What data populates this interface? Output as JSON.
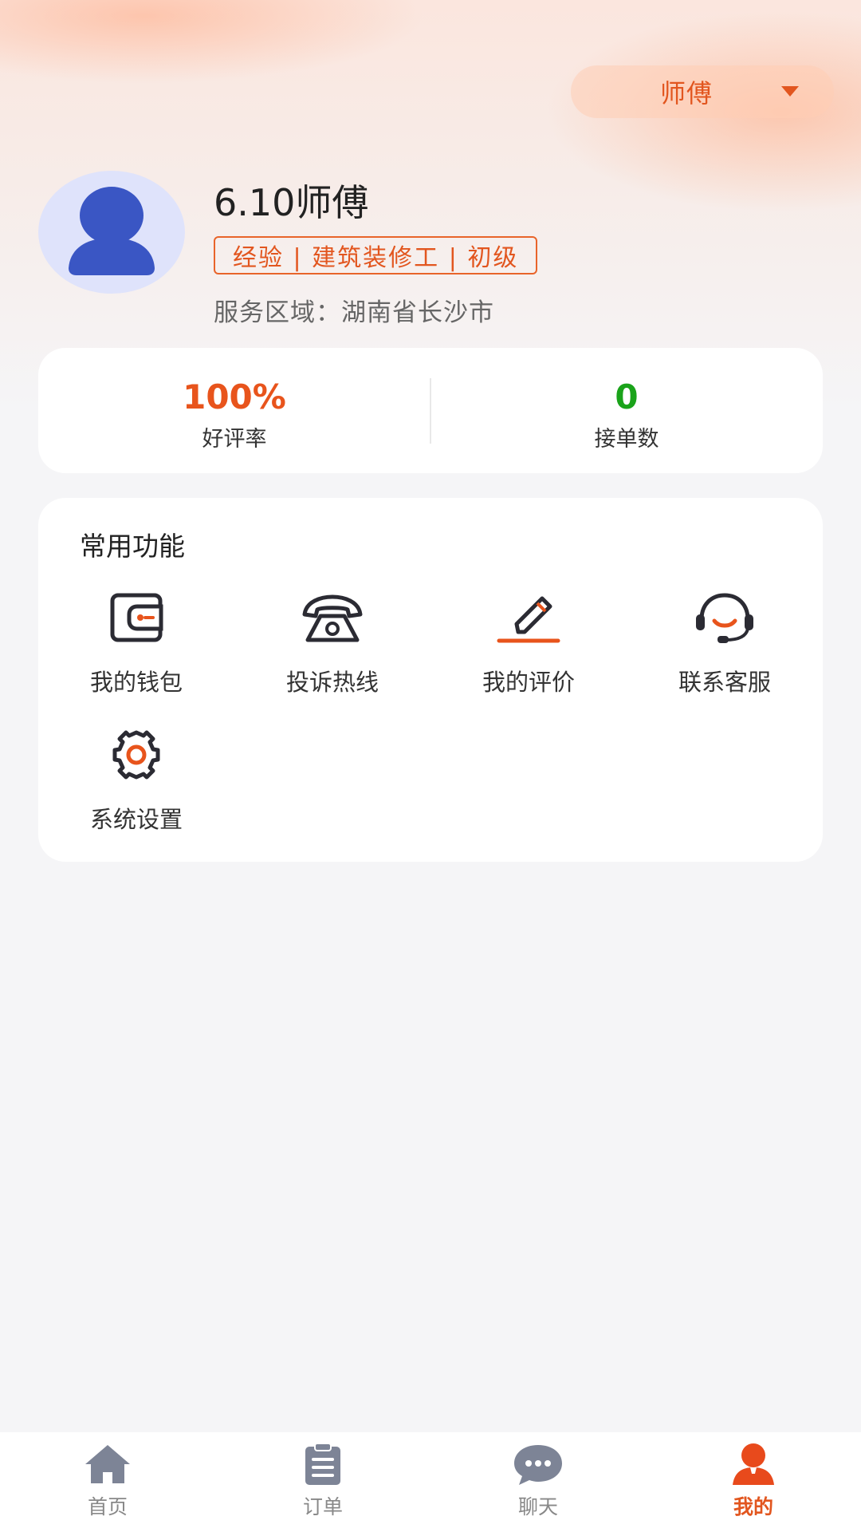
{
  "header": {
    "role_label": "师傅"
  },
  "profile": {
    "name": "6.10师傅",
    "tags": "经验 | 建筑装修工 | 初级",
    "area": "服务区域：湖南省长沙市"
  },
  "stats": [
    {
      "value": "100%",
      "label": "好评率",
      "color": "#e8541c"
    },
    {
      "value": "0",
      "label": "接单数",
      "color": "#1aa31a"
    }
  ],
  "functions": {
    "title": "常用功能",
    "items": [
      {
        "label": "我的钱包",
        "icon": "wallet-icon"
      },
      {
        "label": "投诉热线",
        "icon": "telephone-icon"
      },
      {
        "label": "我的评价",
        "icon": "pencil-icon"
      },
      {
        "label": "联系客服",
        "icon": "headset-icon"
      },
      {
        "label": "系统设置",
        "icon": "gear-icon"
      }
    ]
  },
  "tabbar": {
    "tabs": [
      {
        "label": "首页",
        "icon": "home-icon"
      },
      {
        "label": "订单",
        "icon": "clipboard-icon"
      },
      {
        "label": "聊天",
        "icon": "chat-icon"
      },
      {
        "label": "我的",
        "icon": "person-icon",
        "active": true
      }
    ]
  },
  "colors": {
    "accent": "#e2561f",
    "icon_dark": "#2b2b33",
    "avatar_bg": "#dfe3fb",
    "avatar_fg": "#3a56c4"
  }
}
